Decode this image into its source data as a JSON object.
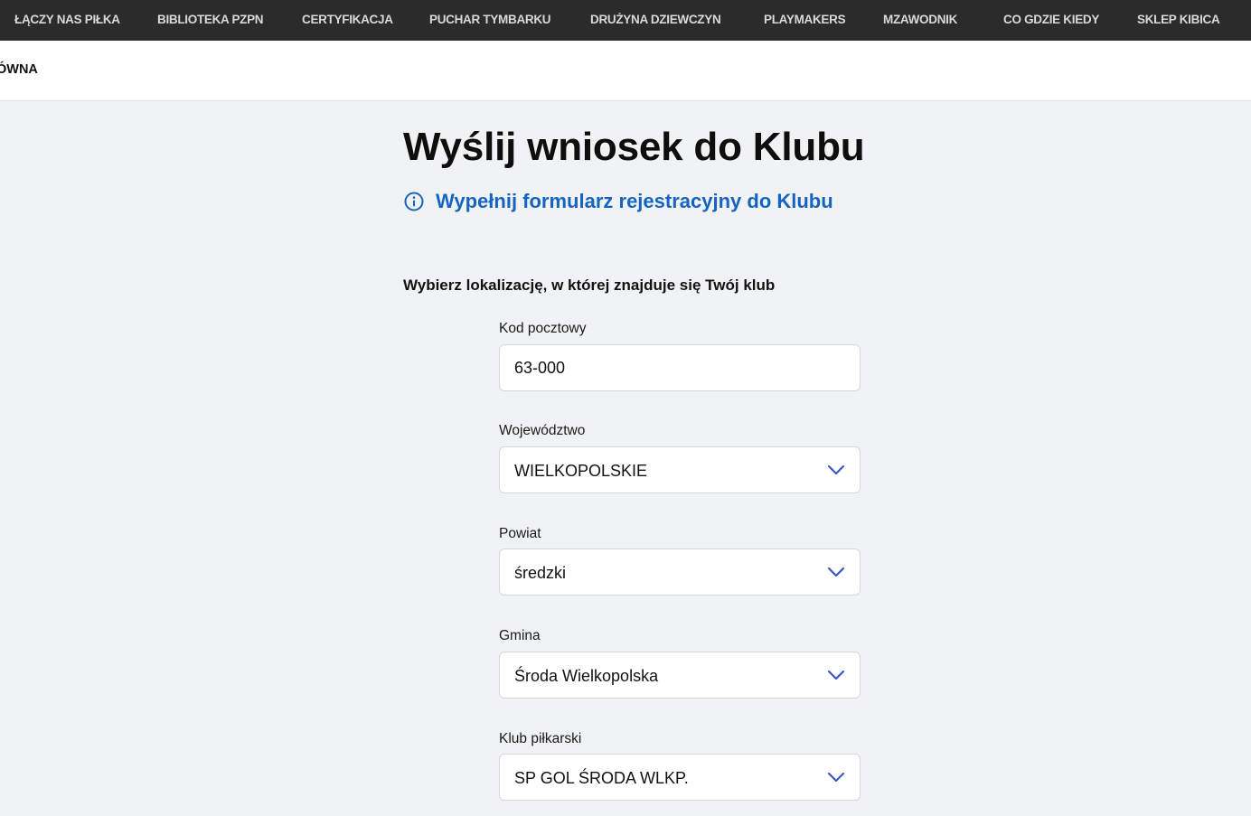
{
  "topnav": {
    "items": [
      {
        "label": "ŁĄCZY NAS PIŁKA"
      },
      {
        "label": "BIBLIOTEKA PZPN"
      },
      {
        "label": "CERTYFIKACJA"
      },
      {
        "label": "PUCHAR TYMBARKU"
      },
      {
        "label": "DRUŻYNA DZIEWCZYN"
      },
      {
        "label": "PLAYMAKERS"
      },
      {
        "label": "MZAWODNIK"
      },
      {
        "label": "CO GDZIE KIEDY"
      },
      {
        "label": "SKLEP KIBICA"
      }
    ]
  },
  "subnav": {
    "item_label": "ÓWNA"
  },
  "main": {
    "title": "Wyślij wniosek do Klubu",
    "info_link": "Wypełnij formularz rejestracyjny do Klubu",
    "section_heading": "Wybierz lokalizację, w której znajduje się Twój klub"
  },
  "form": {
    "postal_code": {
      "label": "Kod pocztowy",
      "value": "63-000"
    },
    "voivodeship": {
      "label": "Województwo",
      "value": "WIELKOPOLSKIE"
    },
    "county": {
      "label": "Powiat",
      "value": "średzki"
    },
    "commune": {
      "label": "Gmina",
      "value": "Środa Wielkopolska"
    },
    "club": {
      "label": "Klub piłkarski",
      "value": "SP GOL ŚRODA WLKP."
    }
  },
  "colors": {
    "topnav_bg": "#2b2b2b",
    "page_bg": "#f1f2f4",
    "link_blue": "#1565c0",
    "chevron_blue": "#3d55c4"
  },
  "icons": {
    "info": "info-circle-icon",
    "dropdown": "chevron-down-icon"
  }
}
